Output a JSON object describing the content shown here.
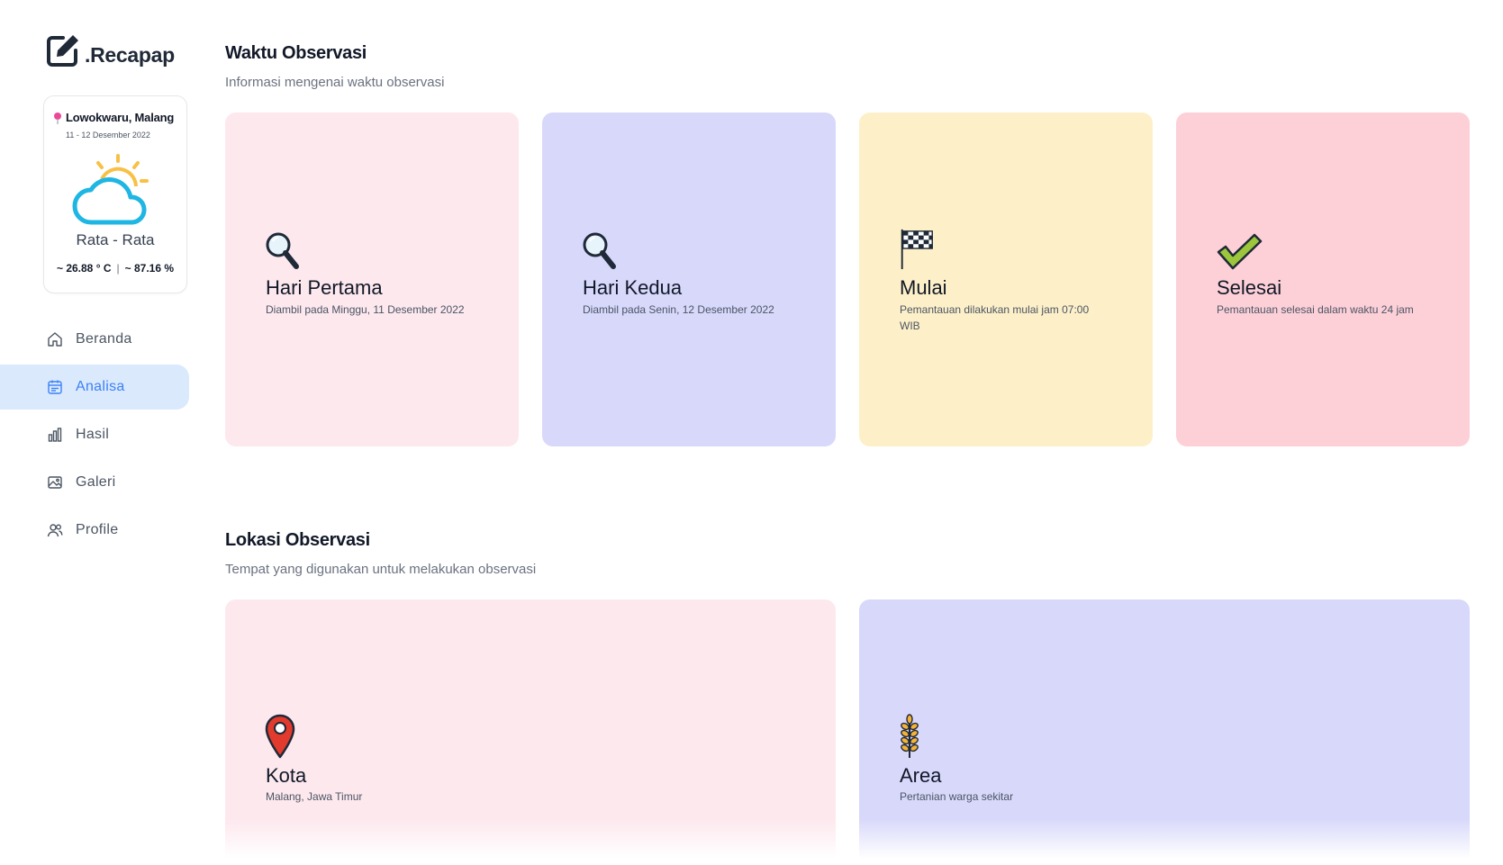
{
  "brand": {
    "name": ".Recapap",
    "icon": "edit-square-icon"
  },
  "weather": {
    "location": "Lowokwaru, Malang",
    "date_range": "11 - 12 Desember 2022",
    "icon": "partly-cloudy-icon",
    "label": "Rata - Rata",
    "temperature": "~ 26.88 ° C",
    "separator": "|",
    "humidity": "~ 87.16 %"
  },
  "nav": {
    "items": [
      {
        "label": "Beranda",
        "icon": "home-icon"
      },
      {
        "label": "Analisa",
        "icon": "calendar-icon",
        "active": true
      },
      {
        "label": "Hasil",
        "icon": "bar-chart-icon"
      },
      {
        "label": "Galeri",
        "icon": "image-icon"
      },
      {
        "label": "Profile",
        "icon": "users-icon"
      }
    ]
  },
  "waktu": {
    "title": "Waktu Observasi",
    "subtitle": "Informasi mengenai waktu observasi",
    "cards": [
      {
        "title": "Hari Pertama",
        "desc": "Diambil pada Minggu, 11 Desember 2022",
        "icon": "magnifier-icon",
        "color": "#fde8ee"
      },
      {
        "title": "Hari Kedua",
        "desc": "Diambil pada Senin, 12 Desember 2022",
        "icon": "magnifier-icon",
        "color": "#d8d8fb"
      },
      {
        "title": "Mulai",
        "desc": "Pemantauan dilakukan mulai jam 07:00 WIB",
        "icon": "checkered-flag-icon",
        "color": "#fdf0c9"
      },
      {
        "title": "Selesai",
        "desc": "Pemantauan selesai dalam waktu 24 jam",
        "icon": "check-mark-icon",
        "color": "#fdd0d8"
      }
    ]
  },
  "lokasi": {
    "title": "Lokasi Observasi",
    "subtitle": "Tempat yang digunakan untuk melakukan observasi",
    "cards": [
      {
        "title": "Kota",
        "desc": "Malang, Jawa Timur",
        "icon": "map-pin-icon",
        "color": "#fde8ee"
      },
      {
        "title": "Area",
        "desc": "Pertanian warga sekitar",
        "icon": "wheat-icon",
        "color": "#d8d8fb"
      }
    ]
  }
}
